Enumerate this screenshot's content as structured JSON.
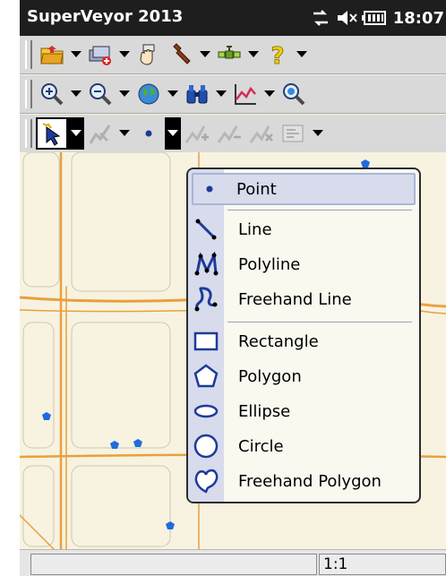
{
  "app": {
    "title": "SuperVeyor 2013"
  },
  "tray": {
    "time": "18:07",
    "icons": [
      "connectivity-icon",
      "volume-muted-icon",
      "battery-icon"
    ]
  },
  "toolbar1": {
    "buttons": [
      "open-folder-icon",
      "add-layer-icon",
      "hand-tool-icon",
      "wrench-icon",
      "gps-satellite-icon",
      "help-icon"
    ]
  },
  "toolbar2": {
    "buttons": [
      "zoom-in-icon",
      "zoom-out-icon",
      "globe-icon",
      "binoculars-icon",
      "profile-chart-icon",
      "zoom-extent-icon"
    ]
  },
  "toolbar3": {
    "buttons": [
      "select-arrow-icon",
      "edit-vertex-icon",
      "point-dot-icon",
      "add-vertex-icon",
      "move-vertex-icon",
      "delete-vertex-icon",
      "attributes-icon"
    ]
  },
  "menu": {
    "items": [
      {
        "label": "Point",
        "icon": "point-icon"
      },
      {
        "label": "Line",
        "icon": "line-icon"
      },
      {
        "label": "Polyline",
        "icon": "polyline-icon"
      },
      {
        "label": "Freehand Line",
        "icon": "freehand-line-icon"
      },
      {
        "label": "Rectangle",
        "icon": "rectangle-icon"
      },
      {
        "label": "Polygon",
        "icon": "polygon-icon"
      },
      {
        "label": "Ellipse",
        "icon": "ellipse-icon"
      },
      {
        "label": "Circle",
        "icon": "circle-icon"
      },
      {
        "label": "Freehand Polygon",
        "icon": "freehand-polygon-icon"
      }
    ],
    "highlighted": "Point"
  },
  "status": {
    "scale": "1:1"
  },
  "colors": {
    "map_bg": "#f7f3e0",
    "road": "#e8a040",
    "point": "#1e6be0",
    "menu_gutter": "#d7dbec"
  }
}
